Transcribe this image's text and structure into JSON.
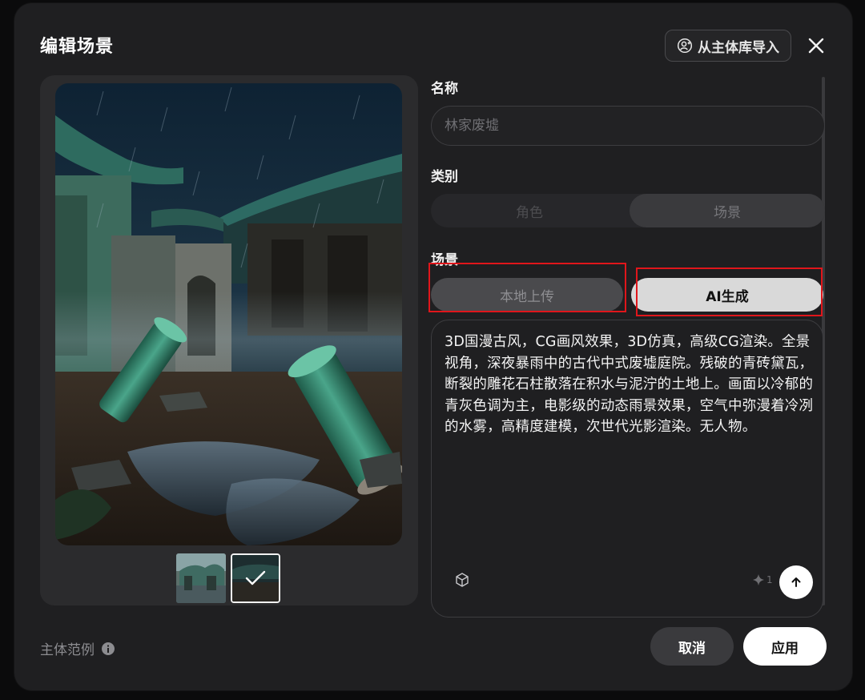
{
  "dialog": {
    "title": "编辑场景",
    "import_button_label": "从主体库导入"
  },
  "form": {
    "name_label": "名称",
    "name_placeholder": "林家废墟",
    "category_label": "类别",
    "category_options": [
      "角色",
      "场景"
    ],
    "category_selected": "场景",
    "scene_label": "场景",
    "source_options": [
      "本地上传",
      "AI生成"
    ],
    "source_selected": "AI生成",
    "prompt_text": "3D国漫古风，CG画风效果，3D仿真，高级CG渲染。全景视角，深夜暴雨中的古代中式废墟庭院。残破的青砖黛瓦，断裂的雕花石柱散落在积水与泥泞的土地上。画面以冷郁的青灰色调为主，电影级的动态雨景效果，空气中弥漫着冷冽的水雾，高精度建模，次世代光影渲染。无人物。",
    "credit_cost": "1"
  },
  "preview": {
    "thumbnail_count": 2,
    "selected_thumbnail": 2
  },
  "footer": {
    "hint": "主体范例",
    "cancel_label": "取消",
    "apply_label": "应用"
  },
  "colors": {
    "modal_bg": "#1f1f21",
    "highlight_red": "#e0161b",
    "selected_pill": "#d9d9d9",
    "apply_bg": "#ffffff"
  }
}
